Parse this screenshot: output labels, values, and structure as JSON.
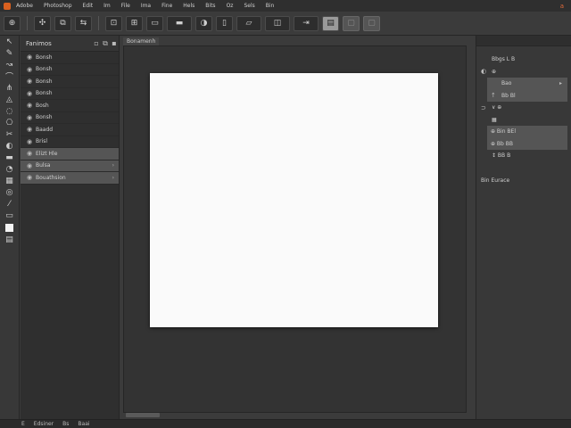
{
  "menubar": {
    "items": [
      "Adobe",
      "Photoshop",
      "Edit",
      "Im",
      "File",
      "Ima",
      "Fine",
      "Hels",
      "Bits",
      "Oz",
      "Sels",
      "Bin"
    ],
    "end": "a"
  },
  "toolbar": {
    "buttons": [
      {
        "icon": "⊕"
      },
      {
        "icon": "✣"
      },
      {
        "icon": "⧉"
      },
      {
        "icon": "⇆"
      },
      {
        "icon": "⊡"
      },
      {
        "icon": "⊞"
      },
      {
        "icon": "▭"
      },
      {
        "icon": "▬"
      },
      {
        "icon": "◑"
      },
      {
        "icon": "▯"
      },
      {
        "icon": "▱"
      },
      {
        "icon": "◫"
      },
      {
        "icon": "⇥"
      },
      {
        "icon": "▤"
      },
      {
        "icon": "▢"
      },
      {
        "icon": "▢"
      }
    ]
  },
  "tools": [
    "↖",
    "✎",
    "↝",
    "⌒",
    "⋔",
    "◬",
    "◌",
    "⎔",
    "✂",
    "◐",
    "▬",
    "◔",
    "▦",
    "◎",
    "⁄",
    "▭",
    "▤"
  ],
  "layers_panel": {
    "title": "Fanimos",
    "icons": [
      "▫",
      "⧉",
      "▪"
    ],
    "layers": [
      {
        "label": "Bonsh",
        "selected": false
      },
      {
        "label": "Bonsh",
        "selected": false
      },
      {
        "label": "Bonsh",
        "selected": false
      },
      {
        "label": "Bonsh",
        "selected": false
      },
      {
        "label": "Bosh",
        "selected": false
      },
      {
        "label": "Bonsh",
        "selected": false
      },
      {
        "label": "Baadd",
        "selected": false
      },
      {
        "label": "Brisl",
        "selected": false
      },
      {
        "label": "Elizt Hle",
        "selected": true
      },
      {
        "label": "Bulsa",
        "selected": true
      },
      {
        "label": "Bouathsion",
        "selected": true
      }
    ]
  },
  "document": {
    "tab": "Bonamenh"
  },
  "right_panel": {
    "rows": [
      {
        "lead": "",
        "label": "Bbgs  L  B",
        "trail": "",
        "selected": false
      },
      {
        "lead": "◐",
        "label": "⊕",
        "trail": "",
        "selected": false
      },
      {
        "lead": "",
        "label": "Bao",
        "trail": "▸",
        "selected": true
      },
      {
        "lead": "↑",
        "label": "Bb  Bl",
        "trail": "",
        "selected": true
      },
      {
        "lead": "⊃",
        "label": "∨  ⊕",
        "trail": "",
        "selected": false
      },
      {
        "lead": "",
        "label": "▦",
        "trail": "",
        "selected": false
      },
      {
        "lead": "",
        "label": "⊕ Bin BEl",
        "trail": "",
        "selected": true
      },
      {
        "lead": "",
        "label": "⊕ Bb BB",
        "trail": "",
        "selected": true
      },
      {
        "lead": "",
        "label": "↕ BB B",
        "trail": "",
        "selected": false
      }
    ],
    "footer": "Bin Eurace"
  },
  "statusbar": {
    "items": [
      "E",
      "Edsiner",
      "Bs",
      "Baai"
    ]
  }
}
